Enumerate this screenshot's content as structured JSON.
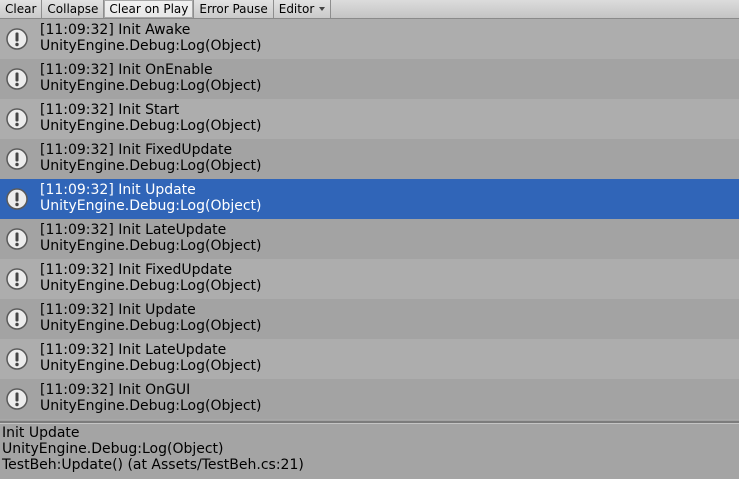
{
  "toolbar": {
    "clear": "Clear",
    "collapse": "Collapse",
    "clear_on_play": "Clear on Play",
    "error_pause": "Error Pause",
    "editor": "Editor"
  },
  "icons": {
    "log_entry": "info-exclamation-icon"
  },
  "colors": {
    "selection": "#3065b8"
  },
  "logs": [
    {
      "message": "[11:09:32] Init Awake",
      "stack": "UnityEngine.Debug:Log(Object)"
    },
    {
      "message": "[11:09:32] Init OnEnable",
      "stack": "UnityEngine.Debug:Log(Object)"
    },
    {
      "message": "[11:09:32] Init Start",
      "stack": "UnityEngine.Debug:Log(Object)"
    },
    {
      "message": "[11:09:32] Init FixedUpdate",
      "stack": "UnityEngine.Debug:Log(Object)"
    },
    {
      "message": "[11:09:32] Init Update",
      "stack": "UnityEngine.Debug:Log(Object)"
    },
    {
      "message": "[11:09:32] Init LateUpdate",
      "stack": "UnityEngine.Debug:Log(Object)"
    },
    {
      "message": "[11:09:32] Init FixedUpdate",
      "stack": "UnityEngine.Debug:Log(Object)"
    },
    {
      "message": "[11:09:32] Init Update",
      "stack": "UnityEngine.Debug:Log(Object)"
    },
    {
      "message": "[11:09:32] Init LateUpdate",
      "stack": "UnityEngine.Debug:Log(Object)"
    },
    {
      "message": "[11:09:32] Init OnGUI",
      "stack": "UnityEngine.Debug:Log(Object)"
    }
  ],
  "details": {
    "line1": "Init Update",
    "line2": "UnityEngine.Debug:Log(Object)",
    "line3": "TestBeh:Update() (at Assets/TestBeh.cs:21)"
  }
}
